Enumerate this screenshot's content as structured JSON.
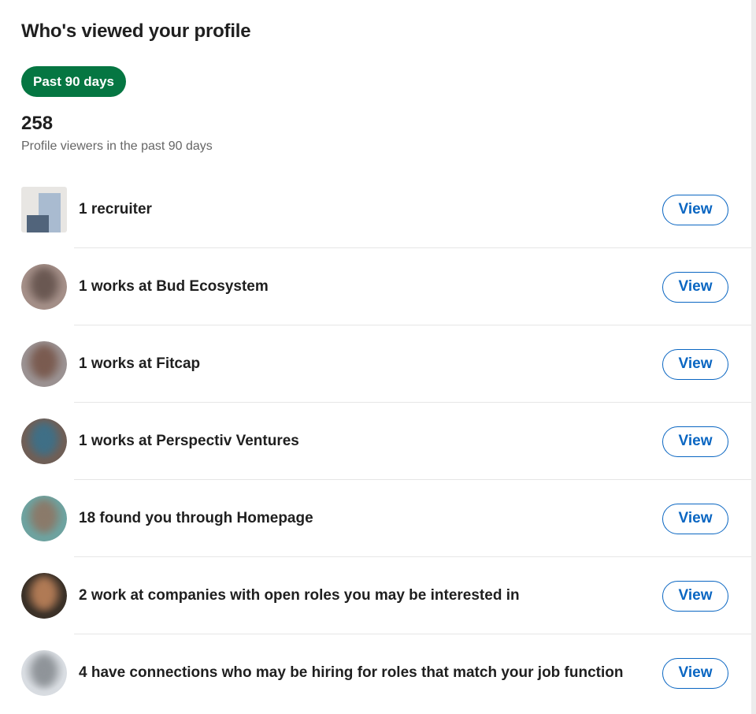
{
  "header": {
    "title": "Who's viewed your profile",
    "filter_label": "Past 90 days"
  },
  "summary": {
    "count": "258",
    "label": "Profile viewers in the past 90 days"
  },
  "viewers": [
    {
      "text": "1 recruiter",
      "button": "View",
      "avatar": "recruiter-icon"
    },
    {
      "text": "1 works at Bud Ecosystem",
      "button": "View",
      "avatar": "blurred-avatar",
      "colors": [
        "#a48f88",
        "#6a5852"
      ]
    },
    {
      "text": "1 works at Fitcap",
      "button": "View",
      "avatar": "blurred-avatar",
      "colors": [
        "#9b9292",
        "#7a5b50"
      ]
    },
    {
      "text": "1 works at Perspectiv Ventures",
      "button": "View",
      "avatar": "blurred-avatar",
      "colors": [
        "#6f5f57",
        "#3f6f86"
      ]
    },
    {
      "text": "18 found you through Homepage",
      "button": "View",
      "avatar": "blurred-avatar",
      "colors": [
        "#6ea3a0",
        "#8a7a6a"
      ]
    },
    {
      "text": "2 work at companies with open roles you may be interested in",
      "button": "View",
      "avatar": "blurred-avatar",
      "colors": [
        "#3b3128",
        "#b07a55"
      ]
    },
    {
      "text": "4 have connections who may be hiring for roles that match your job function",
      "button": "View",
      "avatar": "blurred-avatar",
      "colors": [
        "#d9dde2",
        "#8f9499"
      ]
    }
  ]
}
